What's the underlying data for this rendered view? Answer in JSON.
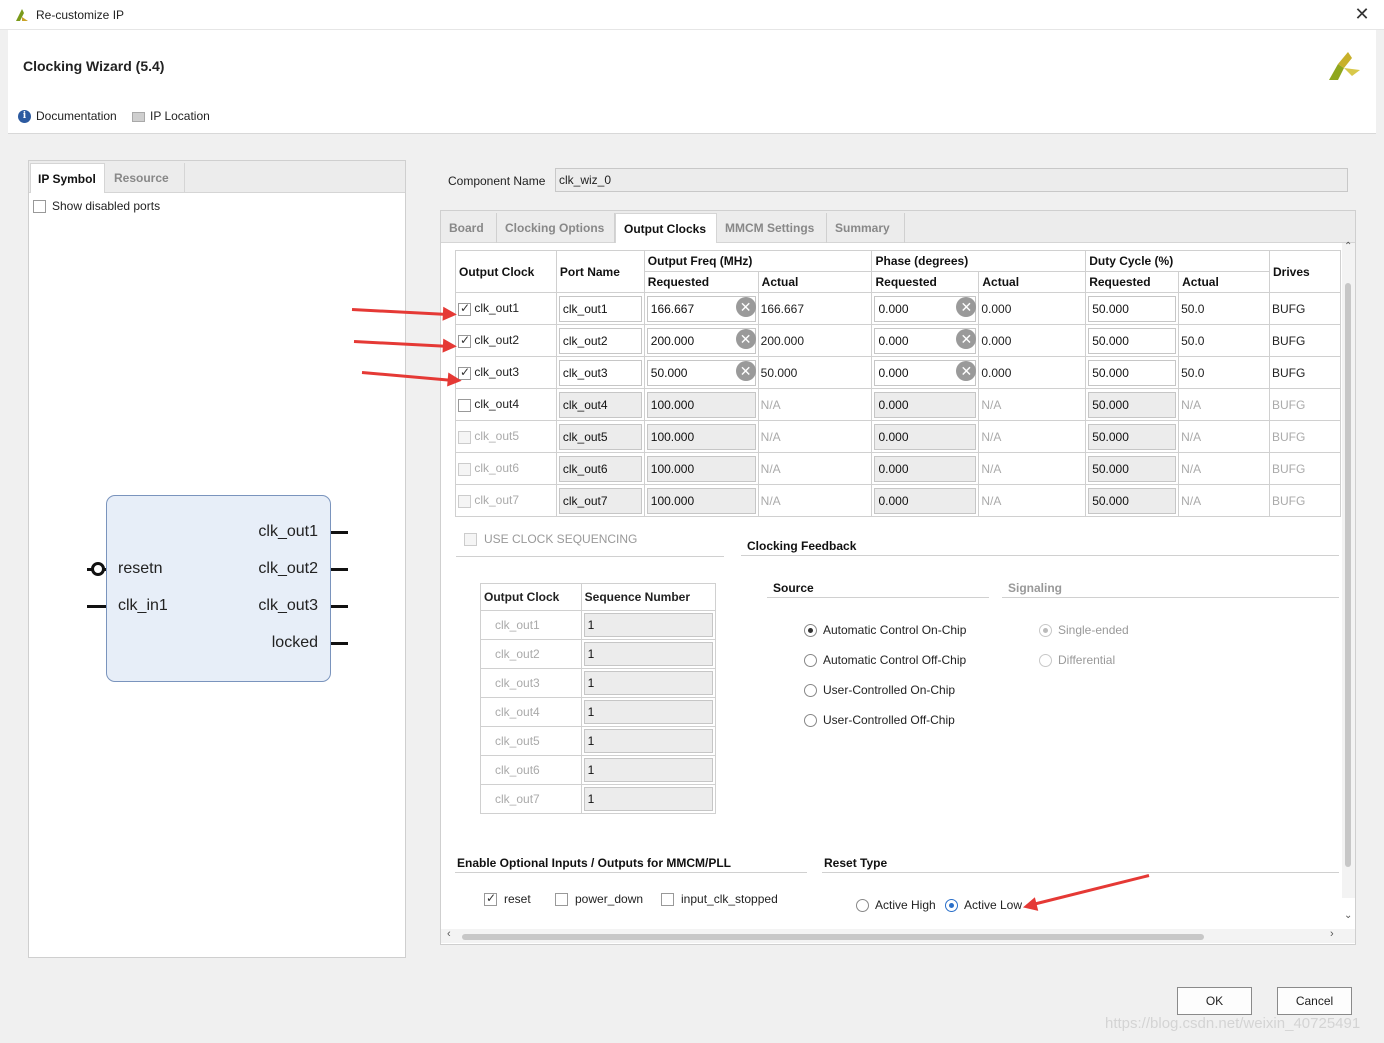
{
  "window": {
    "title": "Re-customize IP",
    "close_icon": "close-icon"
  },
  "header": {
    "wizard_title": "Clocking Wizard (5.4)",
    "documentation": "Documentation",
    "ip_location": "IP Location"
  },
  "left": {
    "tabs": [
      "IP Symbol",
      "Resource"
    ],
    "show_disabled_ports": "Show disabled ports",
    "symbol": {
      "in_pins": [
        "resetn",
        "clk_in1"
      ],
      "out_pins": [
        "clk_out1",
        "clk_out2",
        "clk_out3",
        "locked"
      ]
    }
  },
  "component": {
    "label": "Component Name",
    "value": "clk_wiz_0"
  },
  "tabs": [
    "Board",
    "Clocking Options",
    "Output Clocks",
    "MMCM Settings",
    "Summary"
  ],
  "clock_table": {
    "headers": {
      "output_clock": "Output Clock",
      "port_name": "Port Name",
      "output_freq": "Output Freq (MHz)",
      "phase": "Phase (degrees)",
      "duty": "Duty Cycle (%)",
      "requested": "Requested",
      "actual": "Actual",
      "drives": "Drives"
    },
    "rows": [
      {
        "name": "clk_out1",
        "port": "clk_out1",
        "freq_req": "166.667",
        "freq_act": "166.667",
        "phase_req": "0.000",
        "phase_act": "0.000",
        "duty_req": "50.000",
        "duty_act": "50.0",
        "drives": "BUFG"
      },
      {
        "name": "clk_out2",
        "port": "clk_out2",
        "freq_req": "200.000",
        "freq_act": "200.000",
        "phase_req": "0.000",
        "phase_act": "0.000",
        "duty_req": "50.000",
        "duty_act": "50.0",
        "drives": "BUFG"
      },
      {
        "name": "clk_out3",
        "port": "clk_out3",
        "freq_req": "50.000",
        "freq_act": "50.000",
        "phase_req": "0.000",
        "phase_act": "0.000",
        "duty_req": "50.000",
        "duty_act": "50.0",
        "drives": "BUFG"
      },
      {
        "name": "clk_out4",
        "port": "clk_out4",
        "freq_req": "100.000",
        "freq_act": "N/A",
        "phase_req": "0.000",
        "phase_act": "N/A",
        "duty_req": "50.000",
        "duty_act": "N/A",
        "drives": "BUFG"
      },
      {
        "name": "clk_out5",
        "port": "clk_out5",
        "freq_req": "100.000",
        "freq_act": "N/A",
        "phase_req": "0.000",
        "phase_act": "N/A",
        "duty_req": "50.000",
        "duty_act": "N/A",
        "drives": "BUFG"
      },
      {
        "name": "clk_out6",
        "port": "clk_out6",
        "freq_req": "100.000",
        "freq_act": "N/A",
        "phase_req": "0.000",
        "phase_act": "N/A",
        "duty_req": "50.000",
        "duty_act": "N/A",
        "drives": "BUFG"
      },
      {
        "name": "clk_out7",
        "port": "clk_out7",
        "freq_req": "100.000",
        "freq_act": "N/A",
        "phase_req": "0.000",
        "phase_act": "N/A",
        "duty_req": "50.000",
        "duty_act": "N/A",
        "drives": "BUFG"
      }
    ]
  },
  "sequencing": {
    "label": "USE CLOCK SEQUENCING",
    "headers": [
      "Output Clock",
      "Sequence Number"
    ],
    "rows": [
      {
        "clock": "clk_out1",
        "seq": "1"
      },
      {
        "clock": "clk_out2",
        "seq": "1"
      },
      {
        "clock": "clk_out3",
        "seq": "1"
      },
      {
        "clock": "clk_out4",
        "seq": "1"
      },
      {
        "clock": "clk_out5",
        "seq": "1"
      },
      {
        "clock": "clk_out6",
        "seq": "1"
      },
      {
        "clock": "clk_out7",
        "seq": "1"
      }
    ]
  },
  "feedback": {
    "title": "Clocking Feedback",
    "source_label": "Source",
    "signaling_label": "Signaling",
    "source_options": [
      "Automatic Control On-Chip",
      "Automatic Control Off-Chip",
      "User-Controlled On-Chip",
      "User-Controlled Off-Chip"
    ],
    "signaling_options": [
      "Single-ended",
      "Differential"
    ]
  },
  "optional_io": {
    "title": "Enable Optional Inputs / Outputs for MMCM/PLL",
    "reset": "reset",
    "power_down": "power_down",
    "input_clk_stopped": "input_clk_stopped"
  },
  "reset_type": {
    "title": "Reset Type",
    "active_high": "Active High",
    "active_low": "Active Low"
  },
  "buttons": {
    "ok": "OK",
    "cancel": "Cancel"
  },
  "watermark": "https://blog.csdn.net/weixin_40725491",
  "colors": {
    "annotation_arrow": "#e53935",
    "accent": "#2a6fc9"
  }
}
